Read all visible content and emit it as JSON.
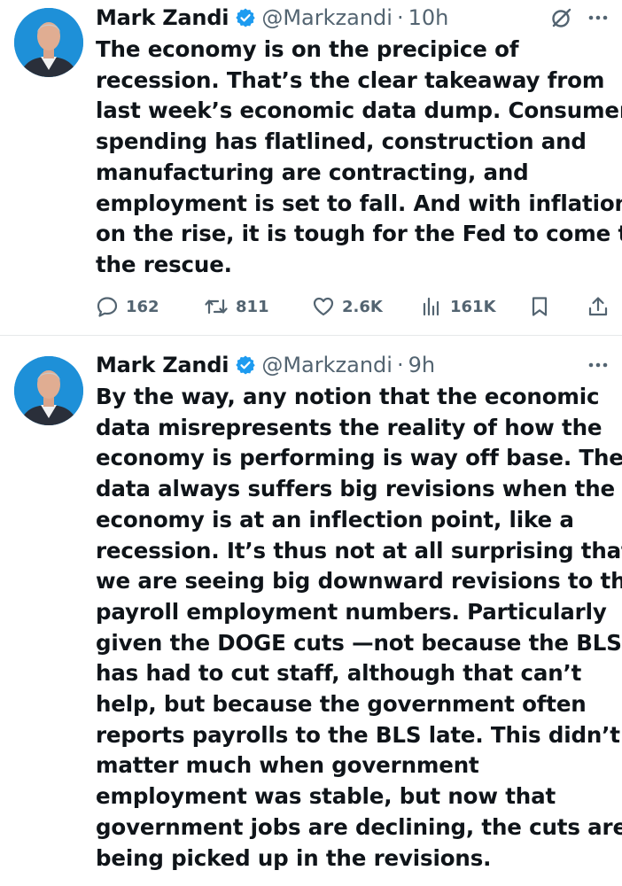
{
  "tweets": [
    {
      "name": "Mark Zandi",
      "handle": "@Markzandi",
      "separator": "·",
      "time": "10h",
      "lines": [
        "The economy is on the precipice of",
        "recession. That’s the clear takeaway from",
        "last week’s economic data dump. Consumer",
        "spending has flatlined, construction and",
        "manufacturing are contracting, and",
        "employment is set to fall. And with inflation",
        "on the rise, it is tough for the Fed to come to",
        "the rescue."
      ],
      "stats": {
        "replies": "162",
        "reposts": "811",
        "likes": "2.6K",
        "views": "161K"
      }
    },
    {
      "name": "Mark Zandi",
      "handle": "@Markzandi",
      "separator": "·",
      "time": "9h",
      "lines": [
        "By the way, any notion that the economic",
        "data misrepresents the reality of how the",
        "economy is performing is way off base. The",
        "data always suffers big revisions when the",
        "economy is at an inflection point, like a",
        "recession. It’s thus not at all surprising that",
        "we are seeing big downward revisions to the",
        "payroll employment numbers. Particularly",
        "given the DOGE cuts —not because the BLS",
        "has had to cut staff, although that can’t",
        "help, but because the government often",
        "reports payrolls to the BLS late. This didn’t",
        "matter much when government",
        "employment was stable, but now that",
        "government jobs are declining, the cuts are",
        "being picked up in the revisions."
      ]
    }
  ],
  "icons": {
    "verified": "verified-badge-icon",
    "grok": "grok-icon",
    "more": "more-icon",
    "reply": "reply-icon",
    "repost": "repost-icon",
    "like": "heart-icon",
    "views": "views-icon",
    "bookmark": "bookmark-icon",
    "share": "share-icon"
  },
  "colors": {
    "verified": "#1d9bf0",
    "secondary_text": "#536471",
    "text": "#0f1419",
    "avatar_bg": "#1d8fd8"
  }
}
